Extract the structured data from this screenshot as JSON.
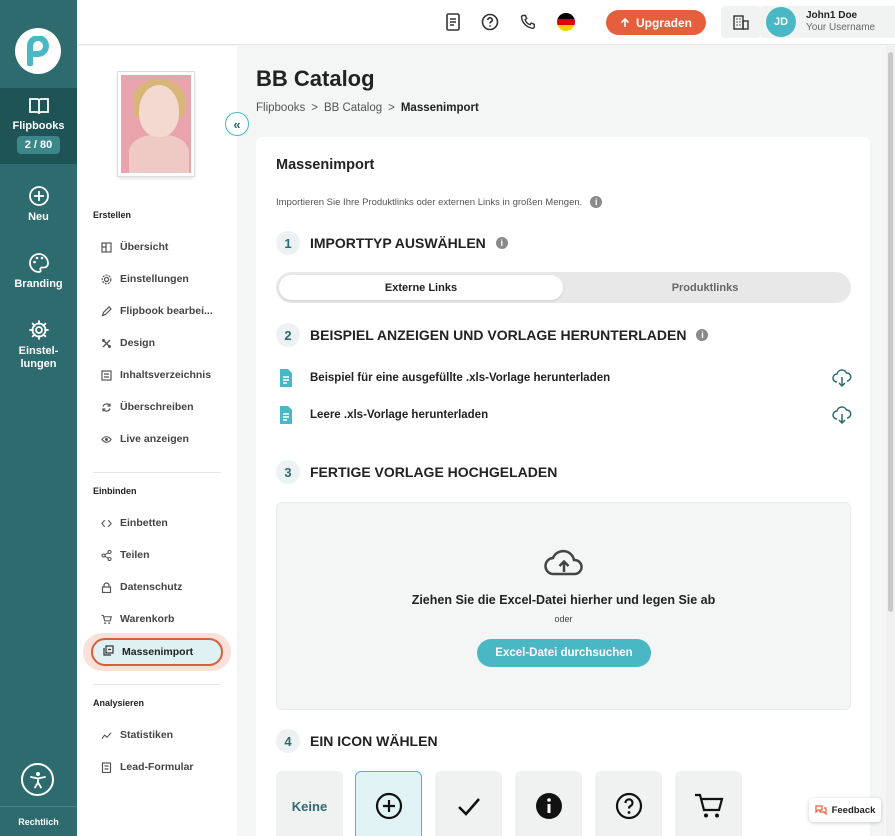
{
  "rail": {
    "logo_icon": "brand-p-logo",
    "items": [
      {
        "label": "Flipbooks",
        "icon": "open-book-icon",
        "badge": "2 / 80"
      },
      {
        "label": "Neu",
        "icon": "plus-circle-icon"
      },
      {
        "label": "Branding",
        "icon": "palette-icon"
      },
      {
        "label": "Einstel-\nlungen",
        "icon": "gear-icon"
      }
    ],
    "bottom_label": "Rechtlich"
  },
  "topbar": {
    "upgrade_label": "Upgraden",
    "language_flag": "de",
    "user": {
      "initials": "JD",
      "name": "John1 Doe",
      "username": "Your Username"
    }
  },
  "sidebar": {
    "sections": [
      {
        "title": "Erstellen",
        "items": [
          {
            "label": "Übersicht",
            "icon": "overview-icon"
          },
          {
            "label": "Einstellungen",
            "icon": "gear-icon"
          },
          {
            "label": "Flipbook bearbei...",
            "icon": "pencil-icon"
          },
          {
            "label": "Design",
            "icon": "design-icon"
          },
          {
            "label": "Inhaltsverzeichnis",
            "icon": "toc-icon"
          },
          {
            "label": "Überschreiben",
            "icon": "refresh-icon"
          },
          {
            "label": "Live anzeigen",
            "icon": "eye-icon"
          }
        ]
      },
      {
        "title": "Einbinden",
        "items": [
          {
            "label": "Einbetten",
            "icon": "code-icon"
          },
          {
            "label": "Teilen",
            "icon": "share-icon"
          },
          {
            "label": "Datenschutz",
            "icon": "lock-icon"
          },
          {
            "label": "Warenkorb",
            "icon": "cart-icon"
          },
          {
            "label": "Massenimport",
            "icon": "bulk-import-icon",
            "active": true
          }
        ]
      },
      {
        "title": "Analysieren",
        "items": [
          {
            "label": "Statistiken",
            "icon": "chart-line-icon"
          },
          {
            "label": "Lead-Formular",
            "icon": "form-icon"
          }
        ]
      }
    ]
  },
  "page": {
    "title": "BB Catalog",
    "breadcrumb": [
      "Flipbooks",
      ">",
      "BB Catalog",
      ">",
      "Massenimport"
    ]
  },
  "card": {
    "title": "Massenimport",
    "description": "Importieren Sie Ihre Produktlinks oder externen Links in großen Mengen.",
    "steps": [
      {
        "num": "1",
        "title": "IMPORTTYP AUSWÄHLEN"
      },
      {
        "num": "2",
        "title": "BEISPIEL ANZEIGEN UND VORLAGE HERUNTERLADEN"
      },
      {
        "num": "3",
        "title": "FERTIGE VORLAGE HOCHGELADEN"
      },
      {
        "num": "4",
        "title": "EIN ICON WÄHLEN"
      }
    ],
    "import_types": [
      "Externe Links",
      "Produktlinks"
    ],
    "selected_import_type": "Externe Links",
    "downloads": [
      "Beispiel für eine ausgefüllte .xls-Vorlage herunterladen",
      "Leere .xls-Vorlage herunterladen"
    ],
    "dropzone": {
      "title": "Ziehen Sie die Excel-Datei hierher und legen Sie ab",
      "or": "oder",
      "button": "Excel-Datei durchsuchen"
    },
    "icon_options": [
      {
        "label": "Keine",
        "icon": "none"
      },
      {
        "label": "",
        "icon": "plus-circle-icon",
        "selected": true
      },
      {
        "label": "",
        "icon": "check-icon"
      },
      {
        "label": "",
        "icon": "info-circle-icon"
      },
      {
        "label": "",
        "icon": "question-circle-icon"
      },
      {
        "label": "",
        "icon": "cart-icon"
      }
    ]
  },
  "feedback_label": "Feedback",
  "colors": {
    "rail": "#2e6b6e",
    "accent": "#4ab8c4",
    "upgrade": "#e55f3c",
    "active_ring": "#d4603c"
  }
}
